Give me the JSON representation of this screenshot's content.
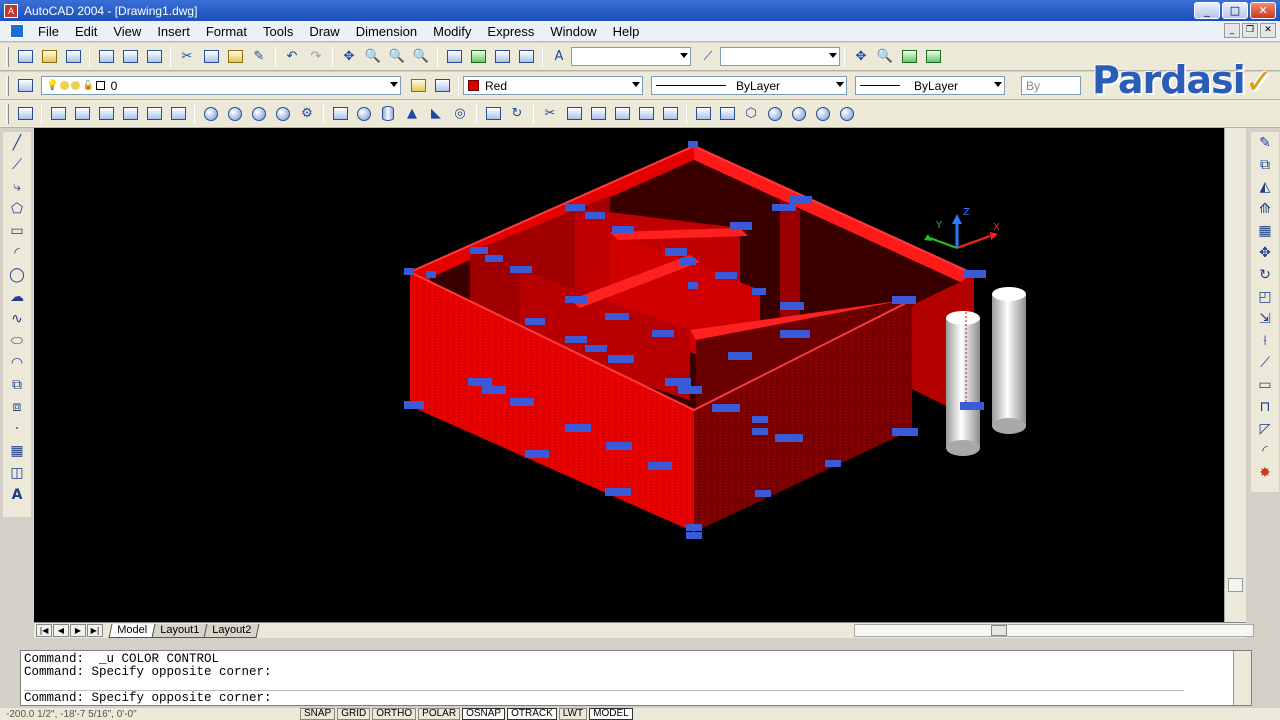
{
  "window": {
    "title": "AutoCAD 2004 - [Drawing1.dwg]",
    "minimize": "_",
    "maximize": "□",
    "close": "✕"
  },
  "menu": [
    "File",
    "Edit",
    "View",
    "Insert",
    "Format",
    "Tools",
    "Draw",
    "Dimension",
    "Modify",
    "Express",
    "Window",
    "Help"
  ],
  "layers": {
    "current": "0",
    "color": "Red",
    "color_hex": "#e00000",
    "linetype": "ByLayer",
    "lineweight": "ByLayer",
    "plotstyle": "By"
  },
  "logo": {
    "text": "Pardasi",
    "mark": "✓"
  },
  "ucs_labels": {
    "x": "X",
    "y": "Y",
    "z": "Z"
  },
  "tabs": {
    "model": "Model",
    "layout1": "Layout1",
    "layout2": "Layout2"
  },
  "command": {
    "lines": [
      "Command:  _u COLOR CONTROL",
      "Command: Specify opposite corner:"
    ],
    "input": "Command: Specify opposite corner:"
  },
  "status": {
    "coords": "-200.0 1/2\",  -18'-7 5/16\",  0'-0\"",
    "buttons": [
      "SNAP",
      "GRID",
      "ORTHO",
      "POLAR",
      "OSNAP",
      "OTRACK",
      "LWT",
      "MODEL"
    ]
  },
  "colors": {
    "wall": "#e50000",
    "wall_dark": "#8a0000",
    "grip": "#3a5ad8",
    "background": "#000000"
  }
}
